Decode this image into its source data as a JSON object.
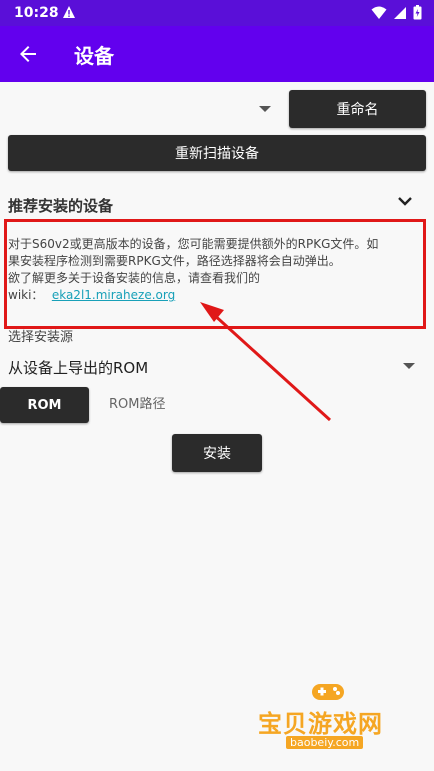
{
  "status_bar": {
    "time": "10:28",
    "icons": [
      "alert-icon",
      "wifi-icon",
      "signal-icon",
      "battery-icon"
    ]
  },
  "app_bar": {
    "title": "设备",
    "back_icon": "arrow-left-icon"
  },
  "toolbar": {
    "rename_label": "重命名",
    "rescan_label": "重新扫描设备"
  },
  "recommended": {
    "title": "推荐安装的设备",
    "info_line1": "对于S60v2或更高版本的设备，您可能需要提供额外的RPKG文件。如",
    "info_line2": "果安装程序检测到需要RPKG文件，路径选择器将会自动弹出。",
    "info_line3": "欲了解更多关于设备安装的信息，请查看我们的",
    "wiki_label": "wiki：",
    "wiki_link": "eka2l1.miraheze.org"
  },
  "install_source": {
    "label": "选择安装源",
    "selected": "从设备上导出的ROM",
    "rom_button": "ROM",
    "rom_path_label": "ROM路径"
  },
  "install_button": "安装",
  "watermark": {
    "title": "宝贝游戏网",
    "url": "baobeiy.com"
  },
  "colors": {
    "app_bar": "#6200ee",
    "status_bar": "#5a0fd8",
    "button": "#2b2b2b",
    "link": "#18a0b8",
    "annotation": "#e01818",
    "watermark": "#f5a623"
  }
}
